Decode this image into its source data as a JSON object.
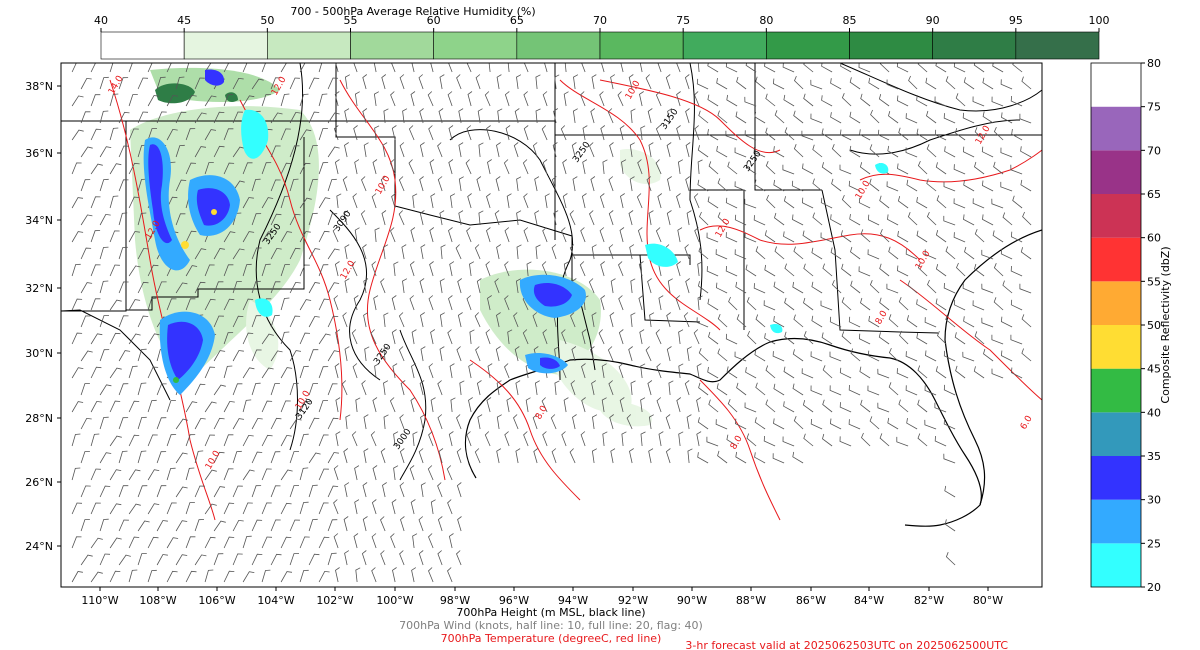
{
  "rh_colorbar": {
    "title": "700 - 500hPa Average Relative Humidity (%)",
    "ticks": [
      "40",
      "45",
      "50",
      "55",
      "60",
      "65",
      "70",
      "75",
      "80",
      "85",
      "90",
      "95",
      "100"
    ],
    "colors": [
      "#ffffff",
      "#e5f5e0",
      "#c7e9c0",
      "#a1d99b",
      "#8ed38a",
      "#74c476",
      "#5ab85f",
      "#41ab5d",
      "#339a48",
      "#2e8b43",
      "#2f7d46",
      "#356f4a"
    ]
  },
  "map": {
    "lat_labels": [
      "38°N",
      "36°N",
      "34°N",
      "32°N",
      "30°N",
      "28°N",
      "26°N",
      "24°N"
    ],
    "lon_labels": [
      "110°W",
      "108°W",
      "106°W",
      "104°W",
      "102°W",
      "100°W",
      "98°W",
      "96°W",
      "94°W",
      "92°W",
      "90°W",
      "88°W",
      "86°W",
      "84°W",
      "82°W",
      "80°W"
    ],
    "height_contour_labels": [
      "3120",
      "3000",
      "3090",
      "3250",
      "3250",
      "3250",
      "3250",
      "3150"
    ],
    "temp_contour_labels": [
      "14.0",
      "12.0",
      "10.0",
      "12.0",
      "10.0",
      "10.0",
      "12.0",
      "10.0",
      "12.0",
      "10.0",
      "8.0",
      "8.0",
      "8.0",
      "10.0",
      "6.0",
      "12.0"
    ],
    "colors": {
      "state_lines": "#000000",
      "coast": "#000000",
      "height": "#000000",
      "temp": "#e8191c",
      "wind": "#555555"
    }
  },
  "reflectivity_colorbar": {
    "label": "Composite Reflectivity (dbZ)",
    "ticks": [
      "20",
      "25",
      "30",
      "35",
      "40",
      "45",
      "50",
      "55",
      "60",
      "65",
      "70",
      "75",
      "80"
    ],
    "colors": [
      "#33ffff",
      "#33aaff",
      "#3333ff",
      "#3399bb",
      "#33bb44",
      "#ffdd33",
      "#ffaa33",
      "#ff3333",
      "#cc3355",
      "#993388",
      "#9966bb",
      "#ffffff"
    ]
  },
  "captions": {
    "height": "700hPa Height (m MSL, black line)",
    "wind": "700hPa Wind (knots, half line: 10, full line: 20, flag: 40)",
    "temp": "700hPa Temperature (degreeC, red line)",
    "valid": "3-hr forecast valid at 2025062503UTC on 2025062500UTC"
  }
}
